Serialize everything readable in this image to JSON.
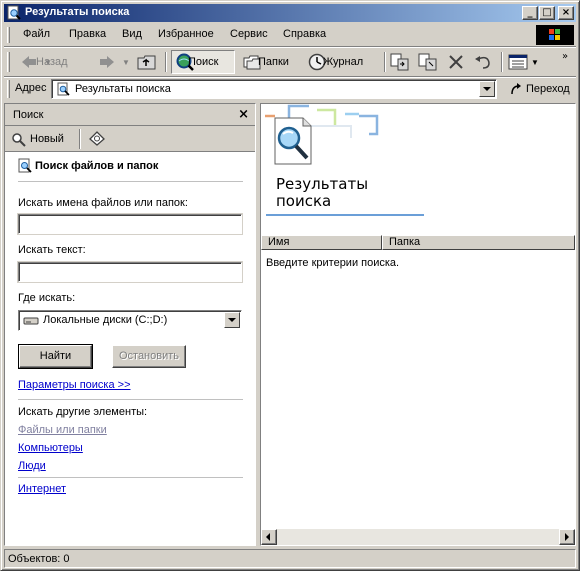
{
  "window": {
    "title": "Результаты поиска"
  },
  "menu": [
    "Файл",
    "Правка",
    "Вид",
    "Избранное",
    "Сервис",
    "Справка"
  ],
  "toolbar": {
    "back": "Назад",
    "search": "Поиск",
    "folders": "Папки",
    "history": "Журнал"
  },
  "address": {
    "label": "Адрес",
    "value": "Результаты поиска",
    "go": "Переход"
  },
  "search_pane": {
    "header": "Поиск",
    "new_button": "Новый",
    "title": "Поиск файлов и папок",
    "names_label": "Искать имена файлов или папок:",
    "names_value": "",
    "text_label": "Искать текст:",
    "text_value": "",
    "where_label": "Где искать:",
    "where_value": "Локальные диски (C:;D:)",
    "find_button": "Найти",
    "stop_button": "Остановить",
    "options_link": "Параметры поиска  >>",
    "other_label": "Искать другие элементы:",
    "other_items": [
      "Файлы или папки",
      "Компьютеры",
      "Люди"
    ],
    "internet": "Интернет"
  },
  "results": {
    "banner_line1": "Результаты",
    "banner_line2": "поиска",
    "columns": [
      "Имя",
      "Папка"
    ],
    "empty_message": "Введите критерии поиска."
  },
  "status": {
    "text": "Объектов: 0"
  },
  "colors": {
    "titlebar_start": "#0a246a",
    "titlebar_end": "#a6caf0",
    "link": "#0000cc",
    "face": "#d4d0c8"
  }
}
